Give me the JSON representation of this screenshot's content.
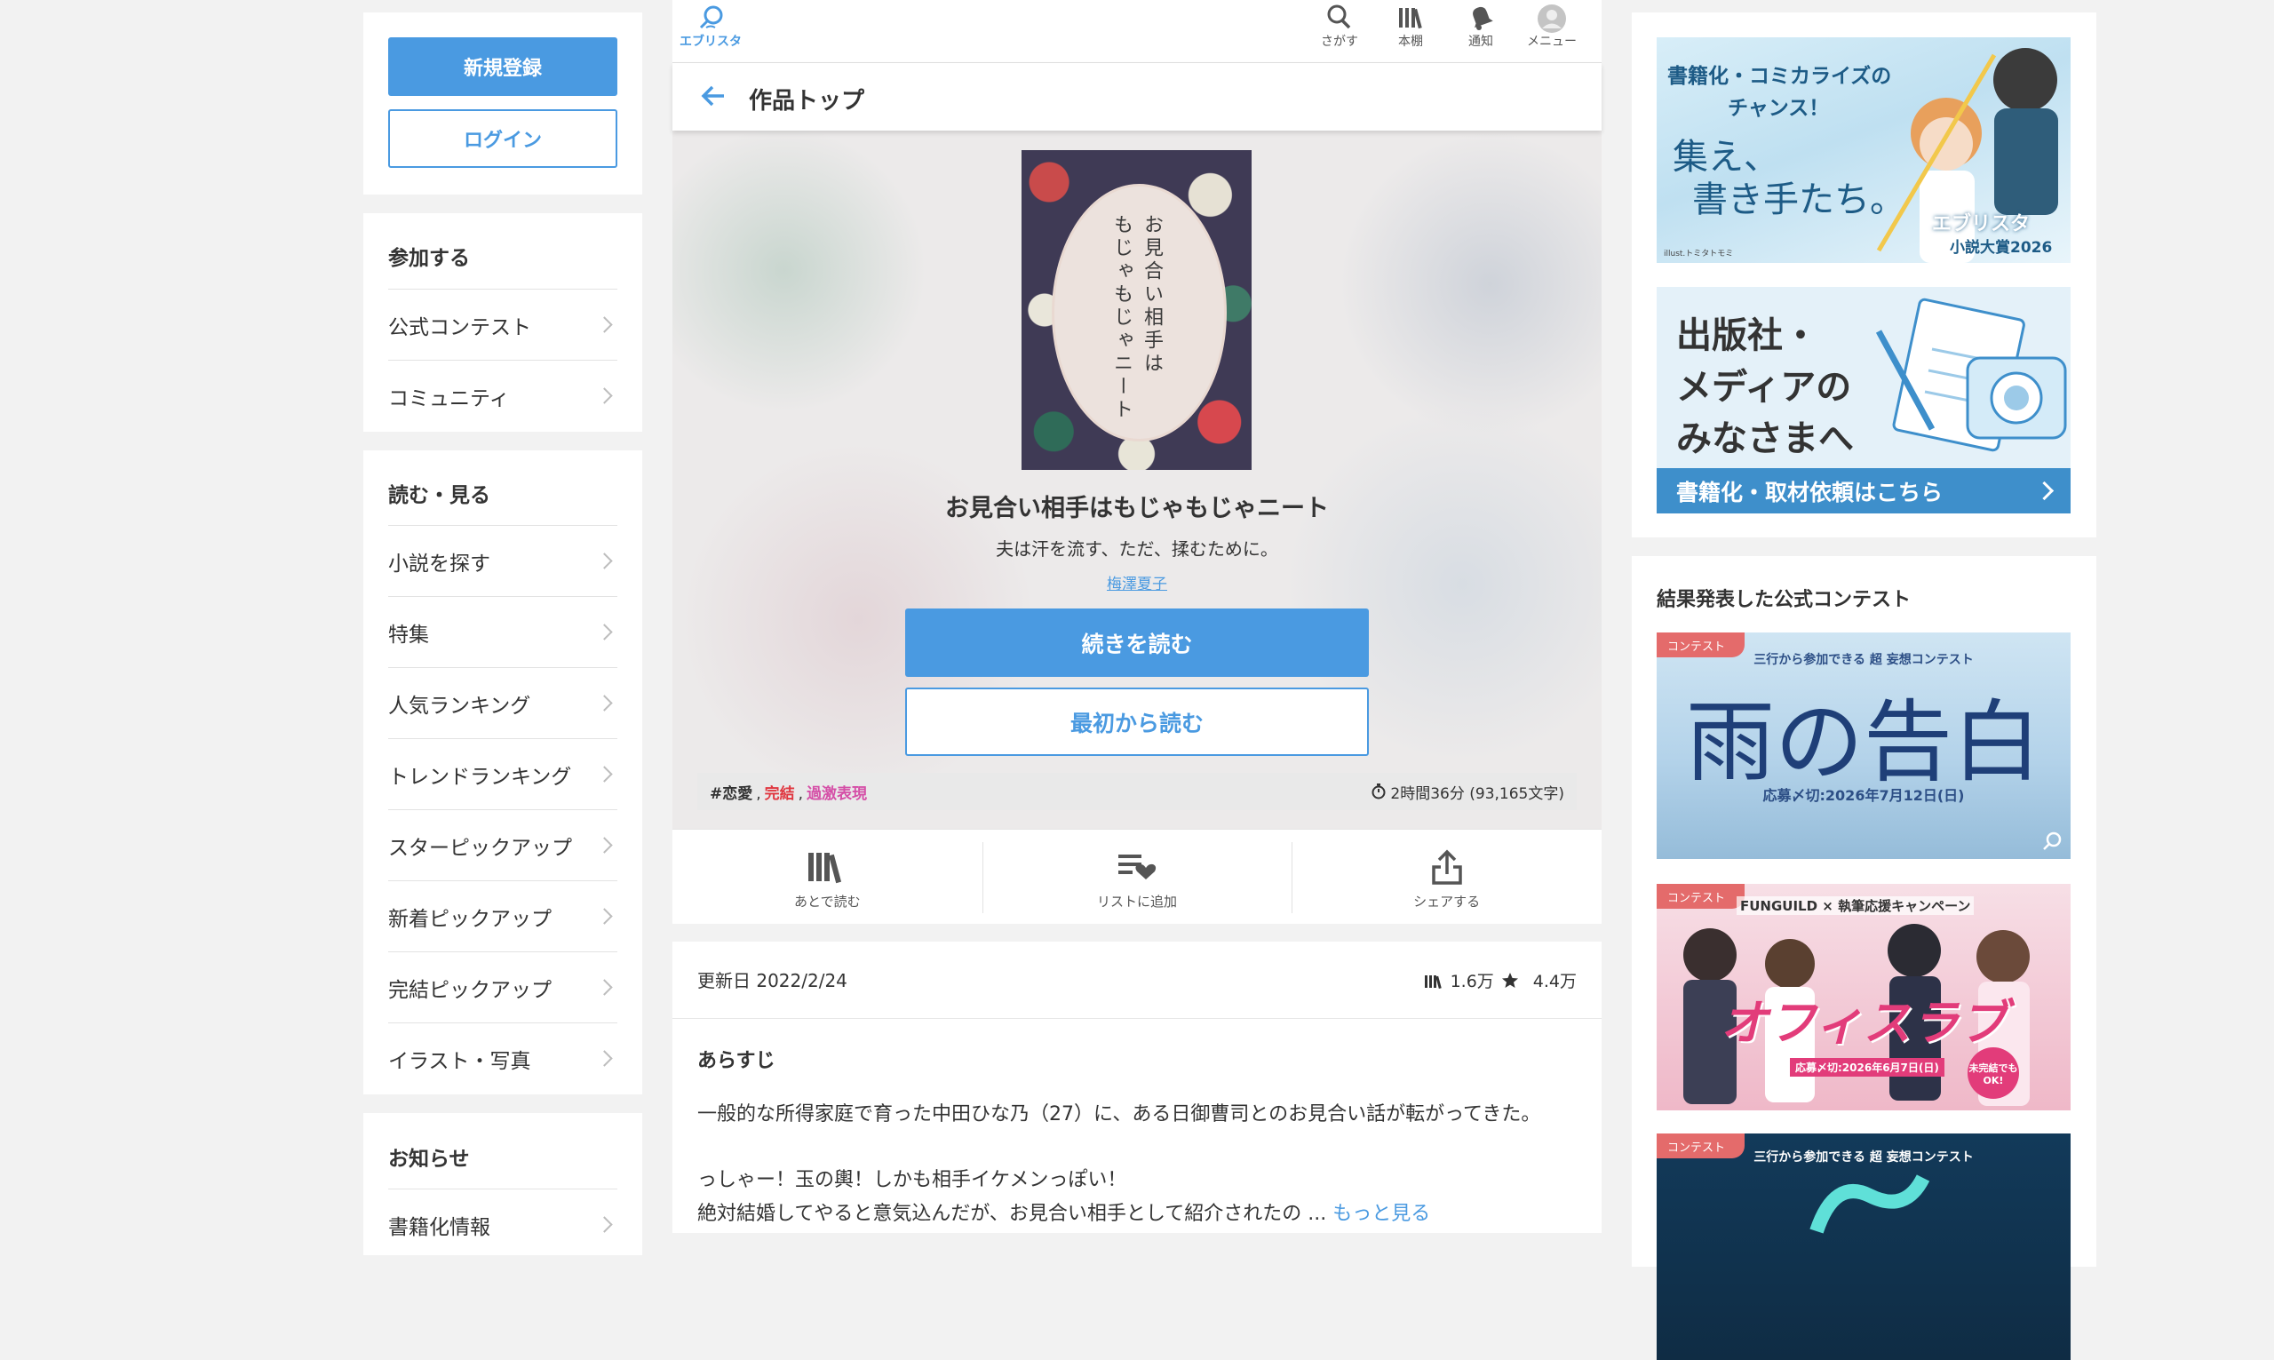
{
  "left": {
    "register": "新規登録",
    "login": "ログイン",
    "participate": {
      "title": "参加する",
      "items": [
        "公式コンテスト",
        "コミュニティ"
      ]
    },
    "read": {
      "title": "読む・見る",
      "items": [
        "小説を探す",
        "特集",
        "人気ランキング",
        "トレンドランキング",
        "スターピックアップ",
        "新着ピックアップ",
        "完結ピックアップ",
        "イラスト・写真"
      ]
    },
    "news": {
      "title": "お知らせ",
      "items": [
        "書籍化情報"
      ]
    }
  },
  "topbar": {
    "logo": "エブリスタ",
    "search": "さがす",
    "bookshelf": "本棚",
    "notify": "通知",
    "menu": "メニュー"
  },
  "subhead": {
    "title": "作品トップ"
  },
  "work": {
    "cover_line1": "お見合い相手は",
    "cover_line2": "もじゃもじゃニート",
    "title": "お見合い相手はもじゃもじゃニート",
    "catch": "夫は汗を流す、ただ、揉むために。",
    "author": "梅澤夏子",
    "read_continue": "続きを読む",
    "read_first": "最初から読む",
    "tag_love": "#恋愛",
    "tag_complete": "完結",
    "tag_violent": "過激表現",
    "sep": ",",
    "read_time": "2時間36分 (93,165文字)"
  },
  "actions": {
    "later": "あとで読む",
    "list": "リストに追加",
    "share": "シェアする"
  },
  "stats": {
    "updated": "更新日 2022/2/24",
    "shelf_count": "1.6万",
    "star_count": "4.4万"
  },
  "synopsis": {
    "title": "あらすじ",
    "line1": "一般的な所得家庭で育った中田ひな乃（27）に、ある日御曹司とのお見合い話が転がってきた。",
    "line2": "っしゃー！玉の輿！しかも相手イケメンっぽい！",
    "line3": "絶対結婚してやると意気込んだが、お見合い相手として紹介されたの ...",
    "more": "もっと見る"
  },
  "right": {
    "banner1": {
      "line1": "書籍化・コミカライズの",
      "line2": "チャンス！",
      "line3": "集え、",
      "line4": "書き手たち。",
      "brand": "エブリスタ",
      "award": "小説大賞2026",
      "credit": "illust.トミタトモミ"
    },
    "banner2": {
      "line1": "出版社・",
      "line2": "メディアの",
      "line3": "みなさまへ",
      "cta": "書籍化・取材依頼はこちら"
    },
    "contests_title": "結果発表した公式コンテスト",
    "contest_tag": "コンテスト",
    "contest1": {
      "sub": "三行から参加できる 超 妄想コンテスト",
      "title": "雨の告白",
      "deadline": "応募〆切:2026年7月12日(日)"
    },
    "contest2": {
      "sub": "FUNGUILD × 執筆応援キャンペーン",
      "title": "オフィスラブ",
      "deadline": "応募〆切:2026年6月7日(日)",
      "badge": "未完結でもOK!"
    },
    "contest3": {
      "sub": "三行から参加できる 超 妄想コンテスト"
    }
  },
  "colors": {
    "accent": "#4a9ae1",
    "tag_complete": "#e0363f",
    "tag_violent": "#d54fa7",
    "background": "#f2f2f2"
  }
}
